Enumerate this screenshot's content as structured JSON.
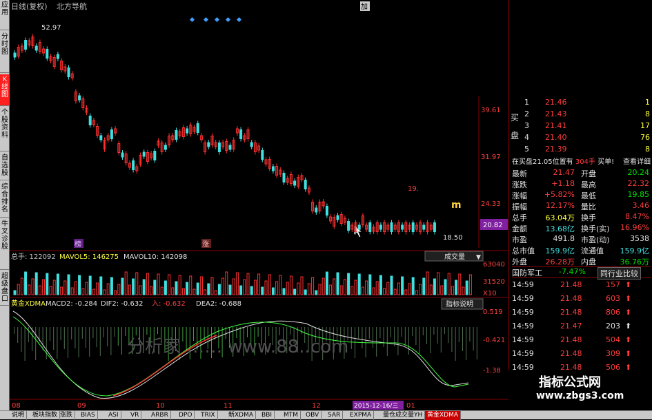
{
  "left_tabs": [
    "应用",
    "分时图",
    "K线图",
    "个股资料",
    "自选股",
    "综合排名",
    "牛叉诊股",
    "超级盘口"
  ],
  "chart_header": {
    "title": "日线(复权)",
    "name": "北方导航",
    "corner": "加"
  },
  "price_labels": {
    "high_marker": "52.97",
    "low_marker": "18.50",
    "axis": [
      "39.61",
      "31.97",
      "24.33"
    ],
    "current": "20.82",
    "marker_a": "榜",
    "marker_b": "涨",
    "marker_c": "19."
  },
  "volume": {
    "label": "总手: 122092",
    "mavol5": "MAVOL5: 146275",
    "mavol10": "MAVOL10: 142098",
    "axis": [
      "63040",
      "31520",
      "X10"
    ],
    "dropdown": "成交量"
  },
  "macd": {
    "label": "黄金XDMA",
    "macd2": "MACD2: -0.284",
    "dif2": "DIF2: -0.632",
    "ru": "入: -0.632",
    "dea2": "DEA2: -0.688",
    "axis": [
      "0.519",
      "-0.421",
      "-1.38"
    ],
    "button": "指标说明"
  },
  "x_axis": {
    "labels": [
      "08",
      "09",
      "10",
      "11",
      "12",
      "01"
    ],
    "highlight": "2015-12-16/三"
  },
  "watermark": "分析家  ……  www.88..com",
  "order_book": {
    "side_label_buy": "买",
    "side_label_pan": "盘",
    "rows": [
      {
        "n": "1",
        "price": "21.46",
        "vol": "1"
      },
      {
        "n": "2",
        "price": "21.43",
        "vol": "8"
      },
      {
        "n": "3",
        "price": "21.41",
        "vol": "17"
      },
      {
        "n": "4",
        "price": "21.40",
        "vol": "76"
      },
      {
        "n": "5",
        "price": "21.39",
        "vol": "8"
      }
    ],
    "note": "在买盘21.05位置有",
    "note_vol": "304手",
    "note_action": "买单!",
    "note_link": "查看详细"
  },
  "stats": [
    {
      "l": "最新",
      "v": "21.47",
      "l2": "开盘",
      "v2": "20.24"
    },
    {
      "l": "涨跌",
      "v": "+1.18",
      "l2": "最高",
      "v2": "22.32"
    },
    {
      "l": "涨幅",
      "v": "+5.82%",
      "l2": "最低",
      "v2": "19.85"
    },
    {
      "l": "振幅",
      "v": "12.17%",
      "l2": "量比",
      "v2": "3.46"
    },
    {
      "l": "总手",
      "v": "63.04万",
      "l2": "换手",
      "v2": "8.47%"
    },
    {
      "l": "金额",
      "v": "13.68亿",
      "l2": "换手(实)",
      "v2": "16.96%"
    },
    {
      "l": "市盈",
      "v": "491.8",
      "l2": "市盈(动)",
      "v2": "3538"
    },
    {
      "l": "总市值",
      "v": "159.9亿",
      "l2": "流通值",
      "v2": "159.9亿"
    },
    {
      "l": "外盘",
      "v": "26.28万",
      "l2": "内盘",
      "v2": "36.76万"
    }
  ],
  "sector": {
    "name": "国防军工",
    "change": "-7.47%",
    "link": "同行业比较"
  },
  "ticks": [
    {
      "t": "14:59",
      "p": "21.48",
      "v": "157",
      "d": "up"
    },
    {
      "t": "14:59",
      "p": "21.48",
      "v": "603",
      "d": "up"
    },
    {
      "t": "14:59",
      "p": "21.48",
      "v": "806",
      "d": "up"
    },
    {
      "t": "14:59",
      "p": "21.47",
      "v": "203",
      "d": "upw"
    },
    {
      "t": "14:59",
      "p": "21.48",
      "v": "504",
      "d": "up"
    },
    {
      "t": "14:59",
      "p": "21.48",
      "v": "309",
      "d": "up"
    },
    {
      "t": "14:59",
      "p": "21.48",
      "v": "506",
      "d": "up"
    },
    {
      "t": "14:59",
      "p": "21.47",
      "v": "634",
      "d": "down"
    }
  ],
  "site": {
    "title": "指标公式网",
    "url": "www.zbgs3.com"
  },
  "bottom_tabs": [
    "说明",
    "板块指数",
    "涨跌",
    "BIAS",
    "ASI",
    "VR",
    "ARBR",
    "DPO",
    "TRIX",
    "新XDMA",
    "BBI",
    "MTM",
    "OBV",
    "SAR",
    "EXPMA",
    "量仓成交量YH",
    "黄金XDMA"
  ]
}
